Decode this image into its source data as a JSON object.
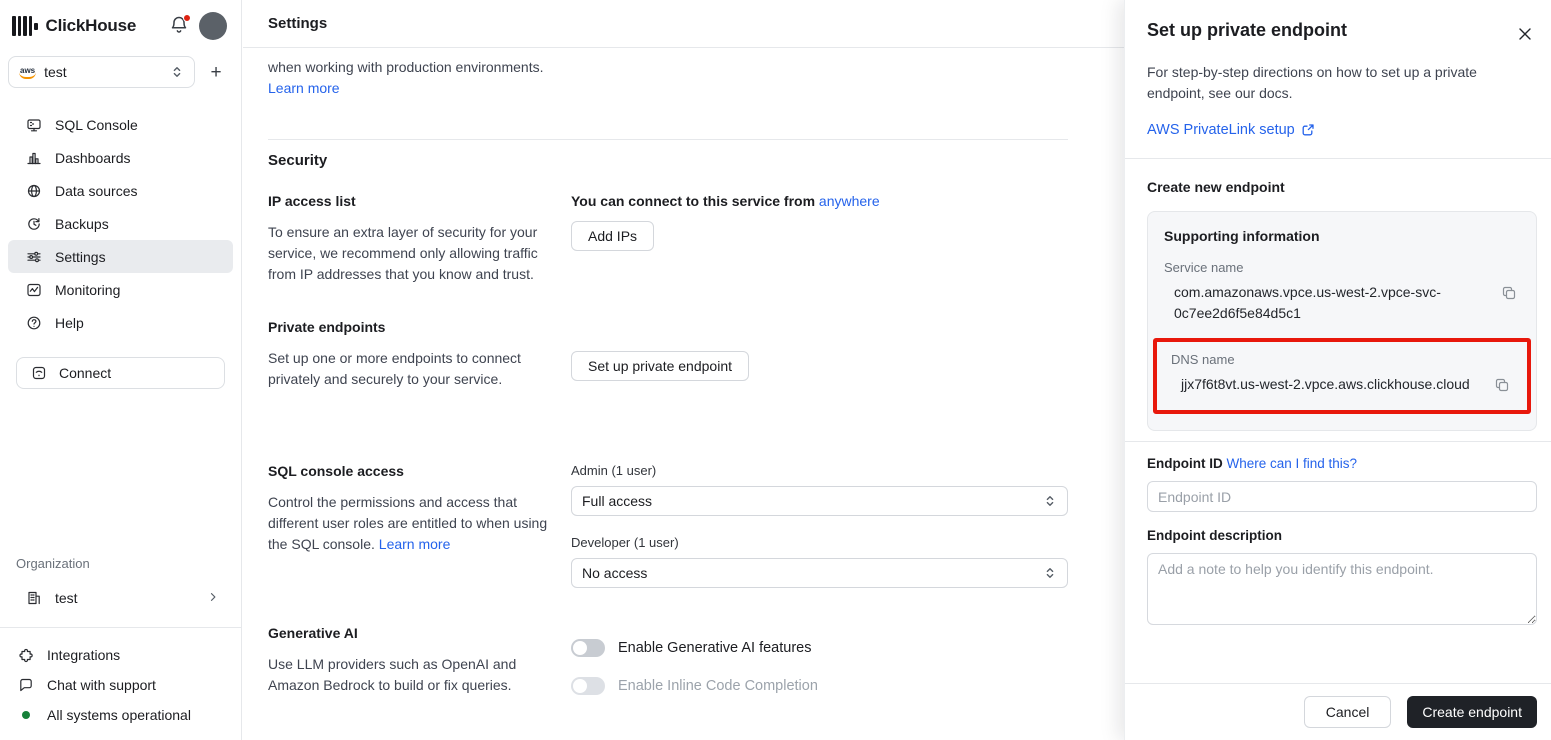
{
  "colors": {
    "accent_blue": "#2563eb",
    "highlight_red": "#e8180c",
    "status_green": "#168139",
    "notification_red": "#dd2211"
  },
  "sidebar": {
    "brand": "ClickHouse",
    "service_selector": {
      "value": "test",
      "provider": "aws"
    },
    "add_service_label": "+",
    "nav": [
      {
        "icon": "sql-console-icon",
        "label": "SQL Console"
      },
      {
        "icon": "dashboards-icon",
        "label": "Dashboards"
      },
      {
        "icon": "data-sources-icon",
        "label": "Data sources"
      },
      {
        "icon": "backups-icon",
        "label": "Backups"
      },
      {
        "icon": "settings-icon",
        "label": "Settings",
        "active": true
      },
      {
        "icon": "monitoring-icon",
        "label": "Monitoring"
      },
      {
        "icon": "help-icon",
        "label": "Help"
      }
    ],
    "connect_label": "Connect",
    "organization": {
      "label": "Organization",
      "name": "test"
    },
    "footer": [
      {
        "icon": "integrations-icon",
        "label": "Integrations"
      },
      {
        "icon": "chat-icon",
        "label": "Chat with support"
      }
    ],
    "status": {
      "label": "All systems operational"
    }
  },
  "header": {
    "title": "Settings"
  },
  "main": {
    "intro": {
      "text": "when working with production environments.",
      "link": "Learn more"
    },
    "security_heading": "Security",
    "ip_access": {
      "title": "IP access list",
      "description": "To ensure an extra layer of security for your service, we recommend only allowing traffic from IP addresses that you know and trust.",
      "status_text": "You can connect to this service from",
      "status_link": "anywhere",
      "button": "Add IPs"
    },
    "private_endpoints": {
      "title": "Private endpoints",
      "description": "Set up one or more endpoints to connect privately and securely to your service.",
      "button": "Set up private endpoint"
    },
    "sql_console_access": {
      "title": "SQL console access",
      "description": "Control the permissions and access that different user roles are entitled to when using the SQL console.",
      "link": "Learn more",
      "roles": [
        {
          "label": "Admin (1 user)",
          "value": "Full access"
        },
        {
          "label": "Developer (1 user)",
          "value": "No access"
        }
      ]
    },
    "generative_ai": {
      "title": "Generative AI",
      "description": "Use LLM providers such as OpenAI and Amazon Bedrock to build or fix queries.",
      "toggles": [
        {
          "label": "Enable Generative AI features",
          "enabled": false
        },
        {
          "label": "Enable Inline Code Completion",
          "enabled": false,
          "disabled": true
        }
      ]
    }
  },
  "panel": {
    "title": "Set up private endpoint",
    "description": "For step-by-step directions on how to set up a private endpoint, see our docs.",
    "docs_link": "AWS PrivateLink setup",
    "create_heading": "Create new endpoint",
    "supporting": {
      "title": "Supporting information",
      "service_name_label": "Service name",
      "service_name": "com.amazonaws.vpce.us-west-2.vpce-svc-0c7ee2d6f5e84d5c1",
      "dns_label": "DNS name",
      "dns_name": "jjx7f6t8vt.us-west-2.vpce.aws.clickhouse.cloud"
    },
    "endpoint_id": {
      "label": "Endpoint ID",
      "link": "Where can I find this?",
      "placeholder": "Endpoint ID",
      "value": ""
    },
    "endpoint_description": {
      "label": "Endpoint description",
      "placeholder": "Add a note to help you identify this endpoint.",
      "value": ""
    },
    "footer": {
      "cancel": "Cancel",
      "submit": "Create endpoint"
    }
  }
}
